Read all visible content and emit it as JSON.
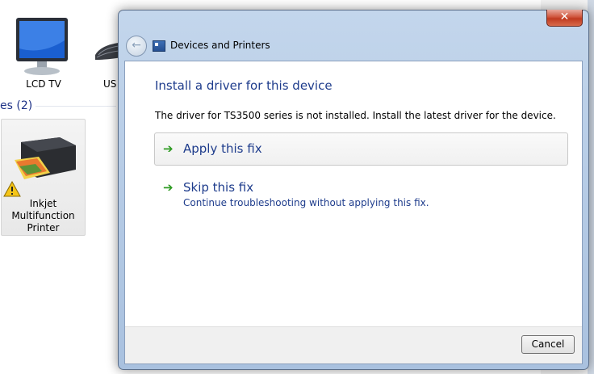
{
  "background": {
    "devices": [
      {
        "label": "LCD TV",
        "icon": "monitor-icon"
      },
      {
        "label": "US",
        "icon": "keyboard-icon"
      }
    ],
    "section_label": "es (2)",
    "printer": {
      "label_lines": [
        "Inkjet",
        "Multifunction",
        "Printer"
      ],
      "icon": "printer-icon",
      "badge": "warning-icon"
    }
  },
  "dialog": {
    "title": "Devices and Printers",
    "close_glyph": "✕",
    "back_glyph": "←",
    "heading": "Install a driver for this device",
    "description": "The driver for TS3500 series is not installed. Install the latest driver for the device.",
    "options": [
      {
        "label": "Apply this fix",
        "sublabel": ""
      },
      {
        "label": "Skip this fix",
        "sublabel": "Continue troubleshooting without applying this fix."
      }
    ],
    "cancel_label": "Cancel"
  },
  "colors": {
    "link_blue": "#1e3c8c",
    "arrow_green": "#2e9b22",
    "close_red": "#c03a20"
  }
}
